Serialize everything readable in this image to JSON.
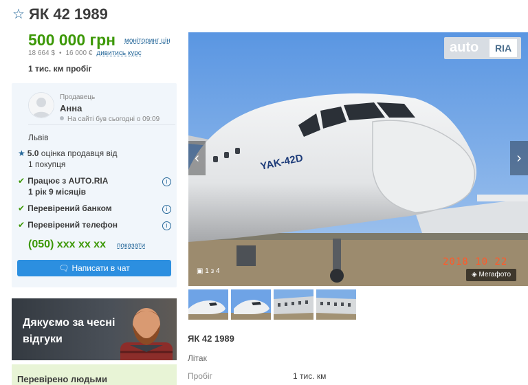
{
  "listing": {
    "title": "ЯК 42 1989",
    "price": "500 000 грн",
    "monitoring_link": "моніторинг цін",
    "price_usd": "18 664 $",
    "price_eur": "16 000 €",
    "course_link": "дивитись курс",
    "mileage": "1 тис. км пробіг"
  },
  "seller": {
    "label": "Продавець",
    "name": "Анна",
    "online_status": "На сайті був сьогодні о 09:09",
    "city": "Львів",
    "rating_value": "5.0",
    "rating_text": "оцінка продавця від",
    "rating_count": "1 покупця",
    "works_with_line1": "Працює з AUTO.RIA",
    "works_with_line2": "1 рік 9 місяців",
    "bank_verified": "Перевірений банком",
    "phone_verified": "Перевірений телефон",
    "phone": "(050) xxx xx xx",
    "show_phone": "показати",
    "chat_button": "Написати в чат"
  },
  "banner": {
    "text": "Дякуємо за чесні відгуки",
    "verified": "Перевірено людьми"
  },
  "gallery": {
    "logo_auto": "auto",
    "logo_ria": "RIA",
    "counter": "1 з 4",
    "date_stamp": "2018 10 22",
    "megaphoto": "Мегафото",
    "aircraft_label": "YAK-42D",
    "prev_icon": "chevron-left-icon",
    "next_icon": "chevron-right-icon"
  },
  "caption": {
    "title": "ЯК 42 1989",
    "type": "Літак",
    "mileage_label": "Пробіг",
    "mileage_value": "1 тис. км"
  },
  "colors": {
    "price_green": "#3c9806",
    "link_blue": "#256799",
    "chat_blue": "#2c8fe0",
    "seller_bg": "#f1f6fb"
  }
}
